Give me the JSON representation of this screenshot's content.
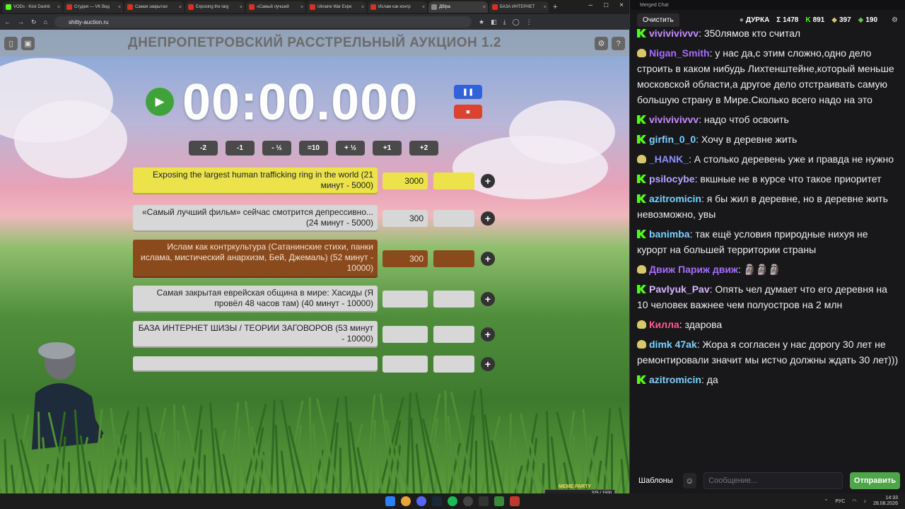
{
  "browser": {
    "tabs": [
      {
        "label": "VODs - Kick Dashb",
        "color": "#53fc18"
      },
      {
        "label": "Студия — VK Вид",
        "color": "#d93025"
      },
      {
        "label": "Самая закрытая",
        "color": "#d93025"
      },
      {
        "label": "Exposing the larg",
        "color": "#d93025"
      },
      {
        "label": "«Самый лучший",
        "color": "#d93025"
      },
      {
        "label": "Ukraine War Expe",
        "color": "#d93025"
      },
      {
        "label": "Ислам как контр",
        "color": "#d93025"
      },
      {
        "label": "Дб/ра",
        "color": "#888888"
      },
      {
        "label": "БАЗА ИНТЕРНЕТ",
        "color": "#d93025"
      }
    ],
    "url": "shitty-auction.ru"
  },
  "app": {
    "title": "ДНЕПРОПЕТРОВСКИЙ РАССТРЕЛЬНЫЙ АУКЦИОН 1.2",
    "timer": "00:00.000",
    "step_buttons": [
      "-2",
      "-1",
      "- ½",
      "=10",
      "+ ½",
      "+1",
      "+2"
    ],
    "lots": [
      {
        "name": "Exposing the largest human trafficking ring in the world (21 минут - 5000)",
        "amount": "3000",
        "style": "yellow"
      },
      {
        "name": "«Самый лучший фильм» сейчас смотрится депрессивно... (24 минут - 5000)",
        "amount": "300",
        "style": "grey"
      },
      {
        "name": "Ислам как контркультура (Сатанинские стихи, панки ислама, мистический анархизм,  Бей, Джемаль) (52 минут - 10000)",
        "amount": "300",
        "style": "brown"
      },
      {
        "name": "Самая закрытая еврейская община в мире: Хасиды (Я провёл 48 часов там) (40 минут - 10000)",
        "amount": "",
        "style": "grey"
      },
      {
        "name": "БАЗА ИНТЕРНЕТ ШИЗЫ / ТЕОРИИ ЗАГОВОРОВ (53 минут - 10000)",
        "amount": "",
        "style": "grey"
      },
      {
        "name": "",
        "amount": "",
        "style": "grey"
      }
    ]
  },
  "chat": {
    "window_title": "Merged Chat",
    "clear_label": "Очистить",
    "channel": "ДУРКА",
    "total": "Σ 1478",
    "kick_count": "891",
    "twitch_count": "397",
    "other_count": "190",
    "messages": [
      {
        "badge": "k",
        "user": "vivivivivvv",
        "color": "#c68cff",
        "text": "350лямов кто считал"
      },
      {
        "badge": "p",
        "user": "Nigan_Smith",
        "color": "#a86bff",
        "text": "у нас да,с этим сложно,одно дело строить в каком нибудь Лихтенштейне,который меньше московской области,а другое дело отстраивать самую большую страну в Мире.Сколько всего надо на это"
      },
      {
        "badge": "k",
        "user": "vivivivivvv",
        "color": "#c68cff",
        "text": "надо чтоб освоить"
      },
      {
        "badge": "k",
        "user": "girfin_0_0",
        "color": "#7cd1ff",
        "text": "Хочу в деревне жить"
      },
      {
        "badge": "p",
        "user": "_HANK_",
        "color": "#8f8fff",
        "text": "А столько деревень уже и правда не нужно"
      },
      {
        "badge": "k",
        "user": "psilocybe",
        "color": "#b6a6ff",
        "text": "вкшные не в курсе что такое приоритет"
      },
      {
        "badge": "k",
        "user": "azitromicin",
        "color": "#7cd1ff",
        "text": "я бы жил в деревне, но в деревне жить невозможно, увы"
      },
      {
        "badge": "k",
        "user": "banimba",
        "color": "#7cd1ff",
        "text": "так ещё условия природные нихуя не курорт на большей территории страны"
      },
      {
        "badge": "p",
        "user": "Движ Париж движ",
        "color": "#a86bff",
        "text": "🗿🗿🗿"
      },
      {
        "badge": "k",
        "user": "Pavlyuk_Pav",
        "color": "#d6b8ff",
        "text": "Опять чел думает что его деревня на 10 человек важнее чем полуостров на 2 млн"
      },
      {
        "badge": "p",
        "user": "Килла",
        "color": "#ff5c8a",
        "text": "здарова"
      },
      {
        "badge": "p",
        "user": "dimk 47ak",
        "color": "#7cd1ff",
        "text": "Жора я согласен у нас дорогу 30 лет не ремонтировали значит мы истчо должны ждать 30 лет)))"
      },
      {
        "badge": "k",
        "user": "azitromicin",
        "color": "#7cd1ff",
        "text": "да"
      }
    ],
    "templates_label": "Шаблоны",
    "input_placeholder": "Сообщение...",
    "send_label": "Отправить"
  },
  "overlay": {
    "party_label": "MEME PARTY",
    "hp_text": "325 / 1500"
  },
  "taskbar": {
    "lang": "РУС",
    "time": "14:33",
    "date": "28.08.2026"
  }
}
